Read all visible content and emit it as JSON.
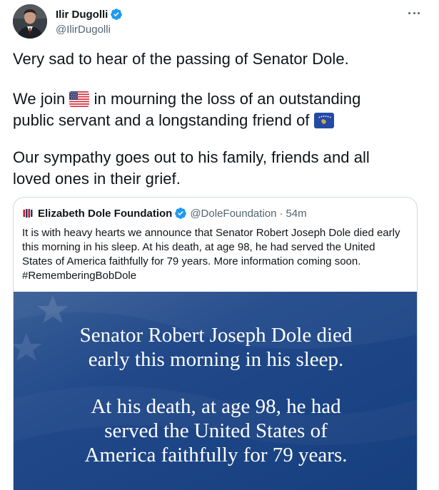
{
  "author": {
    "name": "Ilir Dugolli",
    "handle": "@IlirDugolli",
    "verified_color": "#1d9bf0"
  },
  "tweet": {
    "line1": "Very sad to hear of the passing of Senator Dole.",
    "line2a": "We join",
    "flag2": "us-flag-emoji",
    "line2b": "in mourning the loss of an outstanding",
    "line3": "public servant and a longstanding friend of",
    "flag3": "kosovo-flag-emoji",
    "line4": "Our sympathy goes out to his family, friends and all",
    "line5": "loved ones in their grief."
  },
  "quoted": {
    "name": "Elizabeth Dole Foundation",
    "handle": "@DoleFoundation",
    "separator": "·",
    "time": "54m",
    "text_lines": [
      "It is with heavy hearts we announce that Senator Robert Joseph Dole died early",
      "this morning in his sleep. At his death, at age 98, he had served the United",
      "States of America faithfully for 79 years. More information coming soon.",
      "#RememberingBobDole"
    ],
    "media": {
      "background": "#1e4a87",
      "block1": [
        "Senator Robert Joseph Dole died",
        "early this morning in his sleep."
      ],
      "block2": [
        "At his death, at age 98, he had",
        "served the United States of",
        "America faithfully for 79 years."
      ]
    }
  },
  "icons": {
    "more": "more-horizontal-icon",
    "verified": "verified-badge-icon"
  }
}
